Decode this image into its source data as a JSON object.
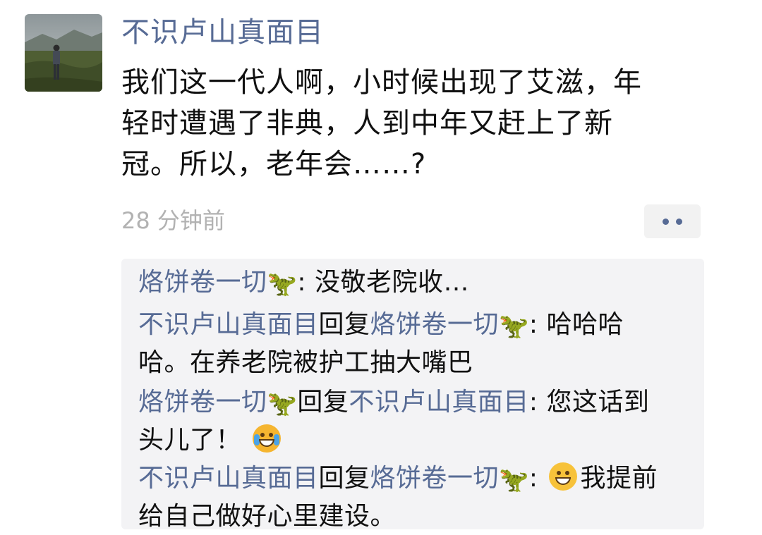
{
  "post": {
    "author": "不识卢山真面目",
    "text_lines": [
      "我们这一代人啊，小时候出现了艾滋，年",
      "轻时遭遇了非典，人到中年又赶上了新",
      "冠。所以，老年会……?"
    ],
    "timestamp": "28 分钟前"
  },
  "icons": {
    "more": "more-dots-icon",
    "dino": "t-rex-emoji-icon",
    "crying": "rolling-laughing-crying-emoji-icon",
    "grin": "grinning-face-emoji-icon"
  },
  "comments": [
    {
      "author": "烙饼卷一切",
      "author_emoji": "🦖",
      "reply_to": "",
      "separator": ":",
      "lines": [
        "没敬老院收…"
      ]
    },
    {
      "author": "不识卢山真面目",
      "reply_word": "回复",
      "reply_to": "烙饼卷一切",
      "reply_to_emoji": "🦖",
      "separator": ":",
      "lines": [
        "哈哈哈",
        "哈。在养老院被护工抽大嘴巴"
      ]
    },
    {
      "author": "烙饼卷一切",
      "author_emoji": "🦖",
      "reply_word": "回复",
      "reply_to": "不识卢山真面目",
      "separator": ":",
      "lines": [
        "您这话到",
        "头儿了！"
      ]
    },
    {
      "author": "不识卢山真面目",
      "reply_word": "回复",
      "reply_to": "烙饼卷一切",
      "reply_to_emoji": "🦖",
      "separator": ":",
      "lines": [
        "我提前",
        "给自己做好心里建设。"
      ]
    }
  ],
  "colors": {
    "link": "#576b95",
    "text": "#111111",
    "muted": "#b2b2b2",
    "comment_bg": "#f3f3f5"
  }
}
